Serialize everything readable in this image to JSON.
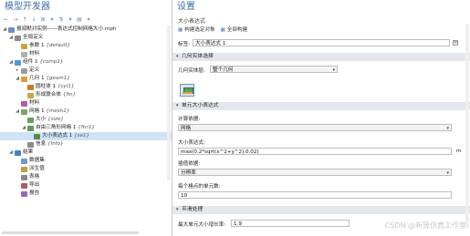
{
  "left": {
    "title": "模型开发器",
    "toolbar": [
      "←",
      "→",
      "↑",
      "↓",
      "⊞",
      "▾",
      "⇅",
      "▾",
      "▤",
      "▾"
    ],
    "tree": [
      {
        "level": 0,
        "toggle": "◢",
        "icon": "model-icon",
        "color": "#6b8fc2",
        "label": "报闻默对实例——表达式控制网格大小.mph",
        "sel": false
      },
      {
        "level": 1,
        "toggle": "◢",
        "icon": "global-defs-icon",
        "color": "#8a8a8a",
        "label": "全局定义",
        "sel": false
      },
      {
        "level": 2,
        "toggle": "",
        "icon": "parameters-icon",
        "color": "#c9a43a",
        "label": "参数 1",
        "tag": "{default}",
        "sel": false
      },
      {
        "level": 2,
        "toggle": "",
        "icon": "materials-icon",
        "color": "#b0b0b0",
        "label": "材料",
        "sel": false
      },
      {
        "level": 1,
        "toggle": "◢",
        "icon": "component-icon",
        "color": "#4a9adb",
        "label": "组件 1",
        "tag": "{comp1}",
        "sel": false
      },
      {
        "level": 2,
        "toggle": "▸",
        "icon": "definitions-icon",
        "color": "#9b9b9b",
        "label": "定义",
        "sel": false
      },
      {
        "level": 2,
        "toggle": "◢",
        "icon": "geometry-icon",
        "color": "#e09b3a",
        "label": "几何 1",
        "tag": "{geom1}",
        "sel": false
      },
      {
        "level": 3,
        "toggle": "",
        "icon": "cylinder-icon",
        "color": "#d07a2a",
        "label": "圆柱体 1",
        "tag": "{cyl1}",
        "sel": false
      },
      {
        "level": 3,
        "toggle": "",
        "icon": "form-union-icon",
        "color": "#d0a24a",
        "label": "形成联合体",
        "tag": "{fin}",
        "sel": false
      },
      {
        "level": 2,
        "toggle": "",
        "icon": "materials-icon",
        "color": "#b55aa3",
        "label": "材料",
        "sel": false
      },
      {
        "level": 2,
        "toggle": "◢",
        "icon": "mesh-icon",
        "color": "#7aa56a",
        "label": "网格 1",
        "tag": "{mesh1}",
        "sel": false
      },
      {
        "level": 3,
        "toggle": "",
        "icon": "size-icon",
        "color": "#6aa05a",
        "label": "大小",
        "tag": "{size}",
        "sel": false
      },
      {
        "level": 3,
        "toggle": "◢",
        "icon": "free-triangular-icon",
        "color": "#5a9a5a",
        "label": "自由三角形网格 1",
        "tag": "{ftri1}",
        "sel": false
      },
      {
        "level": 4,
        "toggle": "",
        "icon": "size-expression-icon",
        "color": "#5a8a4a",
        "label": "大小表达式 1",
        "tag": "{se1}",
        "sel": true
      },
      {
        "level": 3,
        "toggle": "",
        "icon": "info-icon",
        "color": "#8a8a8a",
        "label": "信息",
        "tag": "{info}",
        "sel": false
      },
      {
        "level": 1,
        "toggle": "◢",
        "icon": "results-icon",
        "color": "#4a7ec4",
        "label": "结果",
        "sel": false
      },
      {
        "level": 2,
        "toggle": "",
        "icon": "datasets-icon",
        "color": "#6a9acb",
        "label": "数据集",
        "sel": false
      },
      {
        "level": 2,
        "toggle": "",
        "icon": "derived-values-icon",
        "color": "#c89a3a",
        "label": "派生值",
        "sel": false
      },
      {
        "level": 2,
        "toggle": "",
        "icon": "tables-icon",
        "color": "#8a8a8a",
        "label": "表格",
        "sel": false
      },
      {
        "level": 2,
        "toggle": "",
        "icon": "export-icon",
        "color": "#b05a5a",
        "label": "导出",
        "sel": false
      },
      {
        "level": 2,
        "toggle": "",
        "icon": "reports-icon",
        "color": "#9a6ab0",
        "label": "报告",
        "sel": false
      }
    ]
  },
  "right": {
    "title": "设置",
    "subtitle": "大小表达式",
    "toolbar": {
      "build_selected": "构建选定对象",
      "build_all": "全部构建"
    },
    "label_caption": "标签:",
    "label_value": "大小表达式 1",
    "sections": {
      "geometry_selection": "几何实体选择",
      "single_size_expression": "单元大小表达式",
      "smoothing": "平滑处理"
    },
    "geom_level_caption": "几何实体层:",
    "geom_level_value": "整个几何",
    "evaluate_caption": "计算依据:",
    "evaluate_value": "网格",
    "size_expr_caption": "大小表达式:",
    "size_expr_value": "max(0.2*sqrt(x^2+y^2),0.02)",
    "size_unit": "m",
    "cell_value_caption": "插值依据:",
    "cell_value_value": "分辨率",
    "elements_caption": "每个格点的单元数:",
    "elements_value": "10",
    "max_growth_caption": "最大单元大小增长率:",
    "max_growth_value": "1.9",
    "watermark": "CSDN @新算仿真工作室"
  }
}
